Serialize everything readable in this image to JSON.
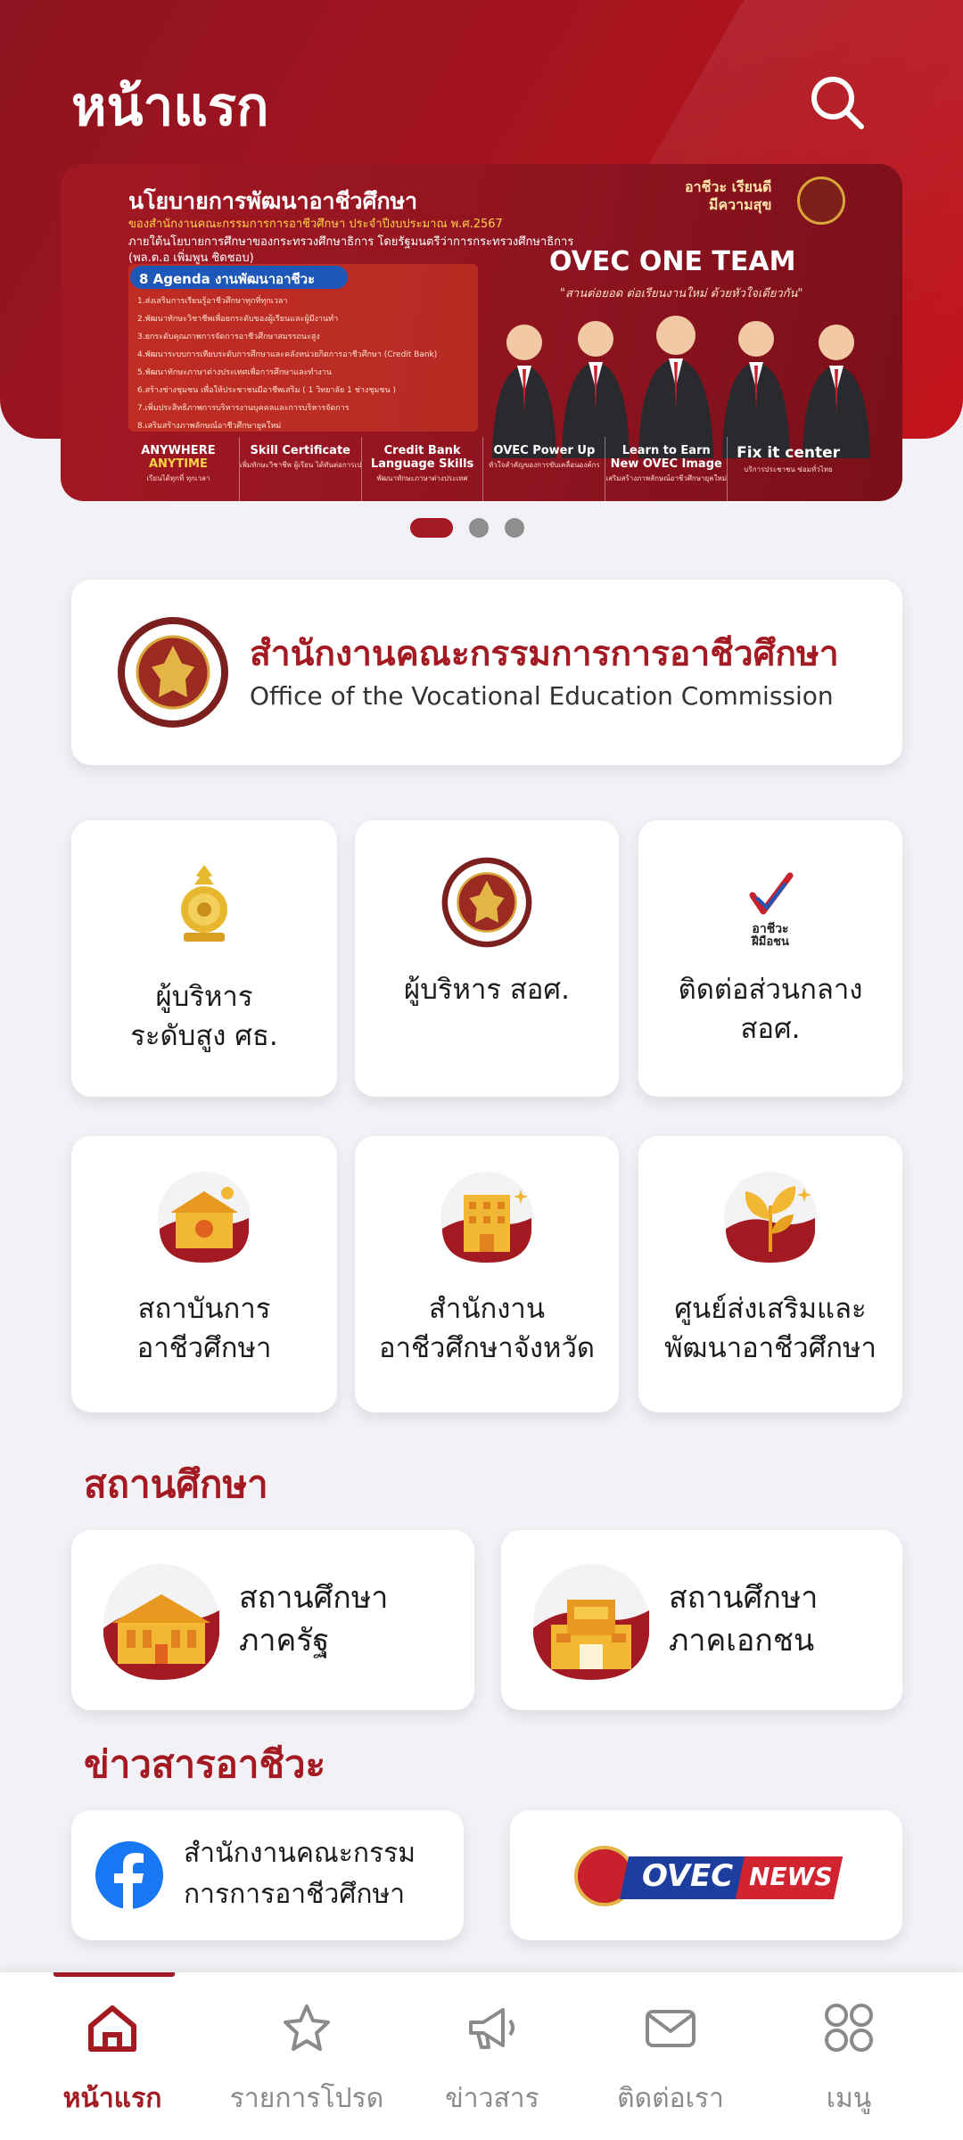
{
  "header": {
    "title": "หน้าแรก",
    "search_icon": "search-icon"
  },
  "banner": {
    "title": "นโยบายการพัฒนาอาชีวศึกษา",
    "sub1": "ของสำนักงานคณะกรรมการการอาชีวศึกษา ประจำปีงบประมาณ พ.ศ.2567",
    "sub2": "ภายใต้นโยบายการศึกษาของกระทรวงศึกษาธิการ โดยรัฐมนตรีว่าการกระทรวงศึกษาธิการ",
    "sub3": "(พล.ต.อ เพิ่มพูน ชิดชอบ)",
    "agenda_title": "8 Agenda งานพัฒนาอาชีวะ",
    "agenda_items": [
      "1.ส่งเสริมการเรียนรู้อาชีวศึกษาทุกที่ทุกเวลา",
      "2.พัฒนาทักษะวิชาชีพเพื่อยกระดับของผู้เรียนและผู้มีงานทำ",
      "3.ยกระดับคุณภาพการจัดการอาชีวศึกษาสมรรถนะสูง",
      "4.พัฒนาระบบการเทียบระดับการศึกษาและคลังหน่วยกิตการอาชีวศึกษา (Credit Bank)",
      "5.พัฒนาทักษะภาษาต่างประเทศเพื่อการศึกษาและทำงาน",
      "6.สร้างช่างชุมชน เพื่อให้ประชาชนมีอาชีพเสริม ( 1 วิทยาลัย 1 ช่างชุมชน )",
      "7.เพิ่มประสิทธิภาพการบริหารงานบุคคลและการบริหารจัดการ",
      "8.เสริมสร้างภาพลักษณ์อาชีวศึกษายุคใหม่"
    ],
    "slogan_line1": "อาชีวะ เรียนดี",
    "slogan_line2": "มีความสุข",
    "team": "OVEC ONE TEAM",
    "team_sub": "\"สานต่อยอด ต่อเรียนงานใหม่ ด้วยหัวใจเดียวกัน\"",
    "footer": [
      {
        "label": "ANYWHERE",
        "label2": "ANYTIME",
        "small": "เรียนได้ทุกที่ ทุกเวลา"
      },
      {
        "label": "Skill Certificate",
        "small": "เพิ่มทักษะวิชาชีพ ผู้เรียน ได้ทันต่อการเปลี่ยนแปลง"
      },
      {
        "label": "Credit Bank",
        "label2": "Language Skills",
        "small": "พัฒนาทักษะภาษาต่างประเทศ"
      },
      {
        "label": "OVEC Power Up",
        "small": "หัวใจสำคัญของการขับเคลื่อนองค์กร"
      },
      {
        "label": "Learn to Earn",
        "label2": "New OVEC Image",
        "small": "เสริมสร้างภาพลักษณ์อาชีวศึกษายุคใหม่"
      },
      {
        "label": "Fix it center",
        "small": "บริการประชาชน ซ่อมทั่วไทย"
      }
    ]
  },
  "carousel": {
    "count": 3,
    "active": 0
  },
  "agency": {
    "name_th": "สำนักงานคณะกรรมการการอาชีวศึกษา",
    "name_en": "Office of the Vocational Education Commission"
  },
  "tiles": [
    {
      "line1": "ผู้บริหาร",
      "line2": "ระดับสูง ศธ.",
      "icon": "moe-emblem-icon"
    },
    {
      "line1": "ผู้บริหาร สอศ.",
      "line2": "",
      "icon": "ovec-seal-icon"
    },
    {
      "line1": "ติดต่อส่วนกลาง",
      "line2": "สอศ.",
      "icon": "vocational-hand-logo-icon",
      "logo_text1": "อาชีวะ",
      "logo_text2": "ฝีมือชน"
    },
    {
      "line1": "สถาบันการ",
      "line2": "อาชีวศึกษา",
      "icon": "institute-building-icon"
    },
    {
      "line1": "สำนักงาน",
      "line2": "อาชีวศึกษาจังหวัด",
      "icon": "provincial-office-building-icon"
    },
    {
      "line1": "ศูนย์ส่งเสริมและ",
      "line2": "พัฒนาอาชีวศึกษา",
      "icon": "plant-leaf-icon"
    }
  ],
  "institutions": {
    "section_title": "สถานศึกษา",
    "items": [
      {
        "line1": "สถานศึกษา",
        "line2": "ภาครัฐ",
        "icon": "public-school-building-icon"
      },
      {
        "line1": "สถานศึกษา",
        "line2": "ภาคเอกชน",
        "icon": "private-school-building-icon"
      }
    ]
  },
  "news": {
    "section_title": "ข่าวสารอาชีวะ",
    "facebook": {
      "line1": "สำนักงานคณะกรรม",
      "line2": "การการอาชีวศึกษา",
      "icon": "facebook-icon"
    },
    "ovec_news": {
      "word1": "OVEC",
      "word2": "NEWS",
      "icon": "ovec-news-logo"
    }
  },
  "nav": {
    "items": [
      {
        "label": "หน้าแรก",
        "icon": "home-icon"
      },
      {
        "label": "รายการโปรด",
        "icon": "star-icon"
      },
      {
        "label": "ข่าวสาร",
        "icon": "megaphone-icon"
      },
      {
        "label": "ติดต่อเรา",
        "icon": "mail-icon"
      },
      {
        "label": "เมนู",
        "icon": "grid-menu-icon"
      }
    ],
    "active_index": 0
  },
  "colors": {
    "brand": "#a31a22",
    "header": "#a3141f",
    "background": "#f2f1f6",
    "gold": "#e8b730"
  }
}
